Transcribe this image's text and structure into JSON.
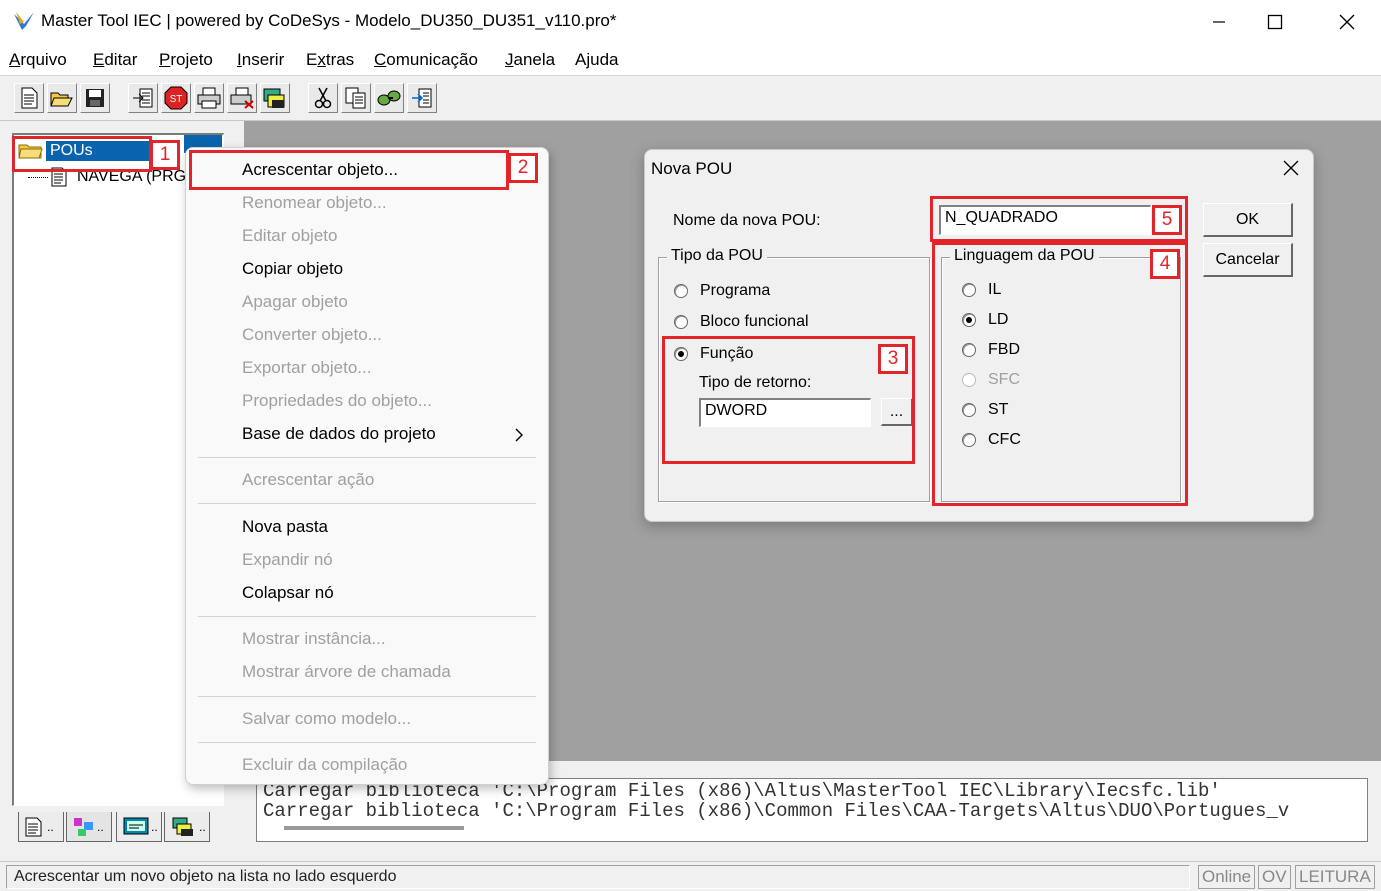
{
  "window": {
    "title": "Master Tool IEC | powered by CoDeSys - Modelo_DU350_DU351_v110.pro*"
  },
  "menu": [
    {
      "label": "Arquivo",
      "u": "A",
      "rest": "rquivo"
    },
    {
      "label": "Editar",
      "u": "E",
      "rest": "ditar"
    },
    {
      "label": "Projeto",
      "u": "P",
      "rest": "rojeto"
    },
    {
      "label": "Inserir",
      "u": "I",
      "rest": "nserir"
    },
    {
      "label": "Extras",
      "u": "x",
      "rest": "tras"
    },
    {
      "label": "Comunicação",
      "u": "C",
      "rest": "omunicação"
    },
    {
      "label": "Janela",
      "u": "J",
      "rest": "anela"
    },
    {
      "label": "Ajuda",
      "u": "j",
      "rest": "uda"
    }
  ],
  "toolbar": [
    "new-file-icon",
    "open-folder-icon",
    "save-icon",
    "login-icon",
    "stop-icon",
    "print-icon",
    "print-preview-icon",
    "build-icon",
    "cut-icon",
    "copy-icon",
    "paste-icon",
    "find-icon"
  ],
  "tree": {
    "root": "POUs",
    "child": "NAVEGA (PRG)"
  },
  "context_menu": [
    {
      "label": "Acrescentar objeto...",
      "enabled": true
    },
    {
      "label": "Renomear objeto...",
      "enabled": false
    },
    {
      "label": "Editar objeto",
      "enabled": false
    },
    {
      "label": "Copiar objeto",
      "enabled": true
    },
    {
      "label": "Apagar objeto",
      "enabled": false
    },
    {
      "label": "Converter objeto...",
      "enabled": false
    },
    {
      "label": "Exportar objeto...",
      "enabled": false
    },
    {
      "label": "Propriedades do objeto...",
      "enabled": false
    },
    {
      "label": "Base de dados do projeto",
      "enabled": true
    },
    {
      "label": "Acrescentar ação",
      "enabled": false
    },
    {
      "label": "Nova pasta",
      "enabled": true
    },
    {
      "label": "Expandir nó",
      "enabled": false
    },
    {
      "label": "Colapsar nó",
      "enabled": true
    },
    {
      "label": "Mostrar instância...",
      "enabled": false
    },
    {
      "label": "Mostrar árvore de chamada",
      "enabled": false
    },
    {
      "label": "Salvar como modelo...",
      "enabled": false
    },
    {
      "label": "Excluir da compilação",
      "enabled": false
    }
  ],
  "dialog": {
    "title": "Nova POU",
    "name_label": "Nome da nova POU:",
    "name_value": "N_QUADRADO",
    "ok": "OK",
    "cancel": "Cancelar",
    "pou_type": {
      "title": "Tipo da POU",
      "options": [
        "Programa",
        "Bloco funcional",
        "Função"
      ],
      "selected": "Função",
      "return_label": "Tipo de retorno:",
      "return_value": "DWORD",
      "browse": "..."
    },
    "language": {
      "title": "Linguagem da POU",
      "options": [
        "IL",
        "LD",
        "FBD",
        "SFC",
        "ST",
        "CFC"
      ],
      "selected": "LD",
      "disabled": "SFC"
    }
  },
  "callouts": [
    "1",
    "2",
    "3",
    "4",
    "5"
  ],
  "messages": [
    "Carregar biblioteca 'C:\\Program Files (x86)\\Altus\\MasterTool IEC\\Library\\Iecsfc.lib'",
    "Carregar biblioteca 'C:\\Program Files (x86)\\Common Files\\CAA-Targets\\Altus\\DUO\\Portugues_v"
  ],
  "status": {
    "text": "Acrescentar um novo objeto na lista no lado esquerdo",
    "online": "Online",
    "ov": "OV",
    "leitura": "LEITURA"
  },
  "colors": {
    "highlight": "#e2252b",
    "selection": "#0a64ad",
    "workspace": "#a0a0a0"
  }
}
